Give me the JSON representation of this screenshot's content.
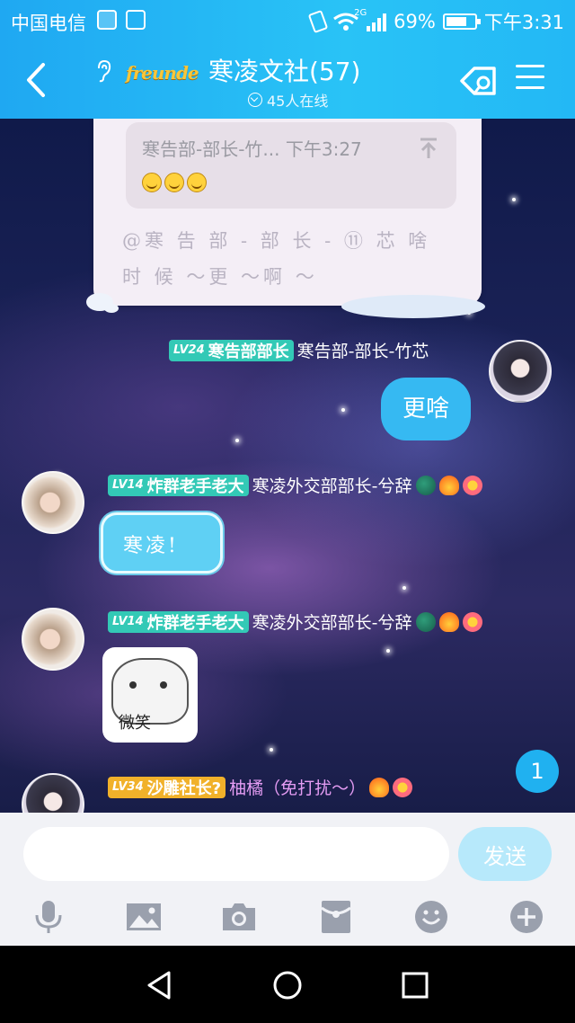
{
  "status_bar": {
    "carrier": "中国电信",
    "network_tag": "2G",
    "battery": "69%",
    "time": "下午3:31"
  },
  "header": {
    "logo_text": "freunde",
    "title": "寒凌文社(57)",
    "online": "45人在线"
  },
  "quote": {
    "header": "寒告部-部长-竹... 下午3:27",
    "body": "@寒 告 部 - 部 长 - ⑪ 芯  啥 时 候 ～更 ～啊 ～"
  },
  "messages": [
    {
      "level": "LV24",
      "title": "寒告部部长",
      "name": "寒告部-部长-竹芯",
      "text": "更啥"
    },
    {
      "level": "LV14",
      "title": "炸群老手老大",
      "name": "寒凌外交部部长-兮辞",
      "text": "寒凌!"
    },
    {
      "level": "LV14",
      "title": "炸群老手老大",
      "name": "寒凌外交部部长-兮辞",
      "sticker_caption": "微笑"
    },
    {
      "level": "LV34",
      "title": "沙雕社长?",
      "name": "柚橘（免打扰～）"
    }
  ],
  "unread_count": "1",
  "input": {
    "placeholder": "",
    "send_label": "发送"
  },
  "toolbar_icons": [
    "microphone-icon",
    "image-icon",
    "camera-icon",
    "red-packet-icon",
    "emoji-icon",
    "plus-icon"
  ],
  "nav_icons": [
    "back-triangle-icon",
    "home-circle-icon",
    "recents-square-icon"
  ],
  "colors": {
    "header": "#29c3f6",
    "bubble_self": "#36b9f2",
    "level_teal": "#33c9b6",
    "level_gold": "#f1b12a",
    "send_button": "#b7e9fb"
  }
}
